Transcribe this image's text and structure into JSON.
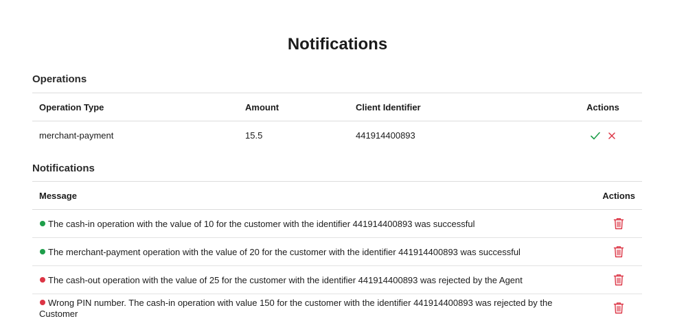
{
  "page": {
    "title": "Notifications"
  },
  "operations": {
    "title": "Operations",
    "columns": [
      "Operation Type",
      "Amount",
      "Client Identifier",
      "Actions"
    ],
    "rows": [
      {
        "type": "merchant-payment",
        "amount": "15.5",
        "client": "441914400893",
        "actions": [
          "check-icon",
          "close-icon"
        ]
      }
    ]
  },
  "notifications": {
    "title": "Notifications",
    "columns": [
      "Message",
      "Actions"
    ],
    "rows": [
      {
        "status": "success",
        "message": "The cash-in operation with the value of 10 for the customer with the identifier 441914400893 was successful",
        "action_icon": "trash-icon"
      },
      {
        "status": "success",
        "message": "The merchant-payment operation with the value of 20 for the customer with the identifier 441914400893 was successful",
        "action_icon": "trash-icon"
      },
      {
        "status": "rejected",
        "message": "The cash-out operation with the value of 25 for the customer with the identifier 441914400893 was rejected by the Agent",
        "action_icon": "trash-icon"
      },
      {
        "status": "rejected",
        "message": "Wrong PIN number. The cash-in operation with value 150 for the customer with the identifier 441914400893 was rejected by the Customer",
        "action_icon": "trash-icon"
      }
    ]
  },
  "colors": {
    "success": "#1e9e4a",
    "rejected": "#dc3545",
    "approve_icon": "#1e9e4a",
    "reject_icon": "#dc3545",
    "trash_icon": "#dc3545"
  }
}
